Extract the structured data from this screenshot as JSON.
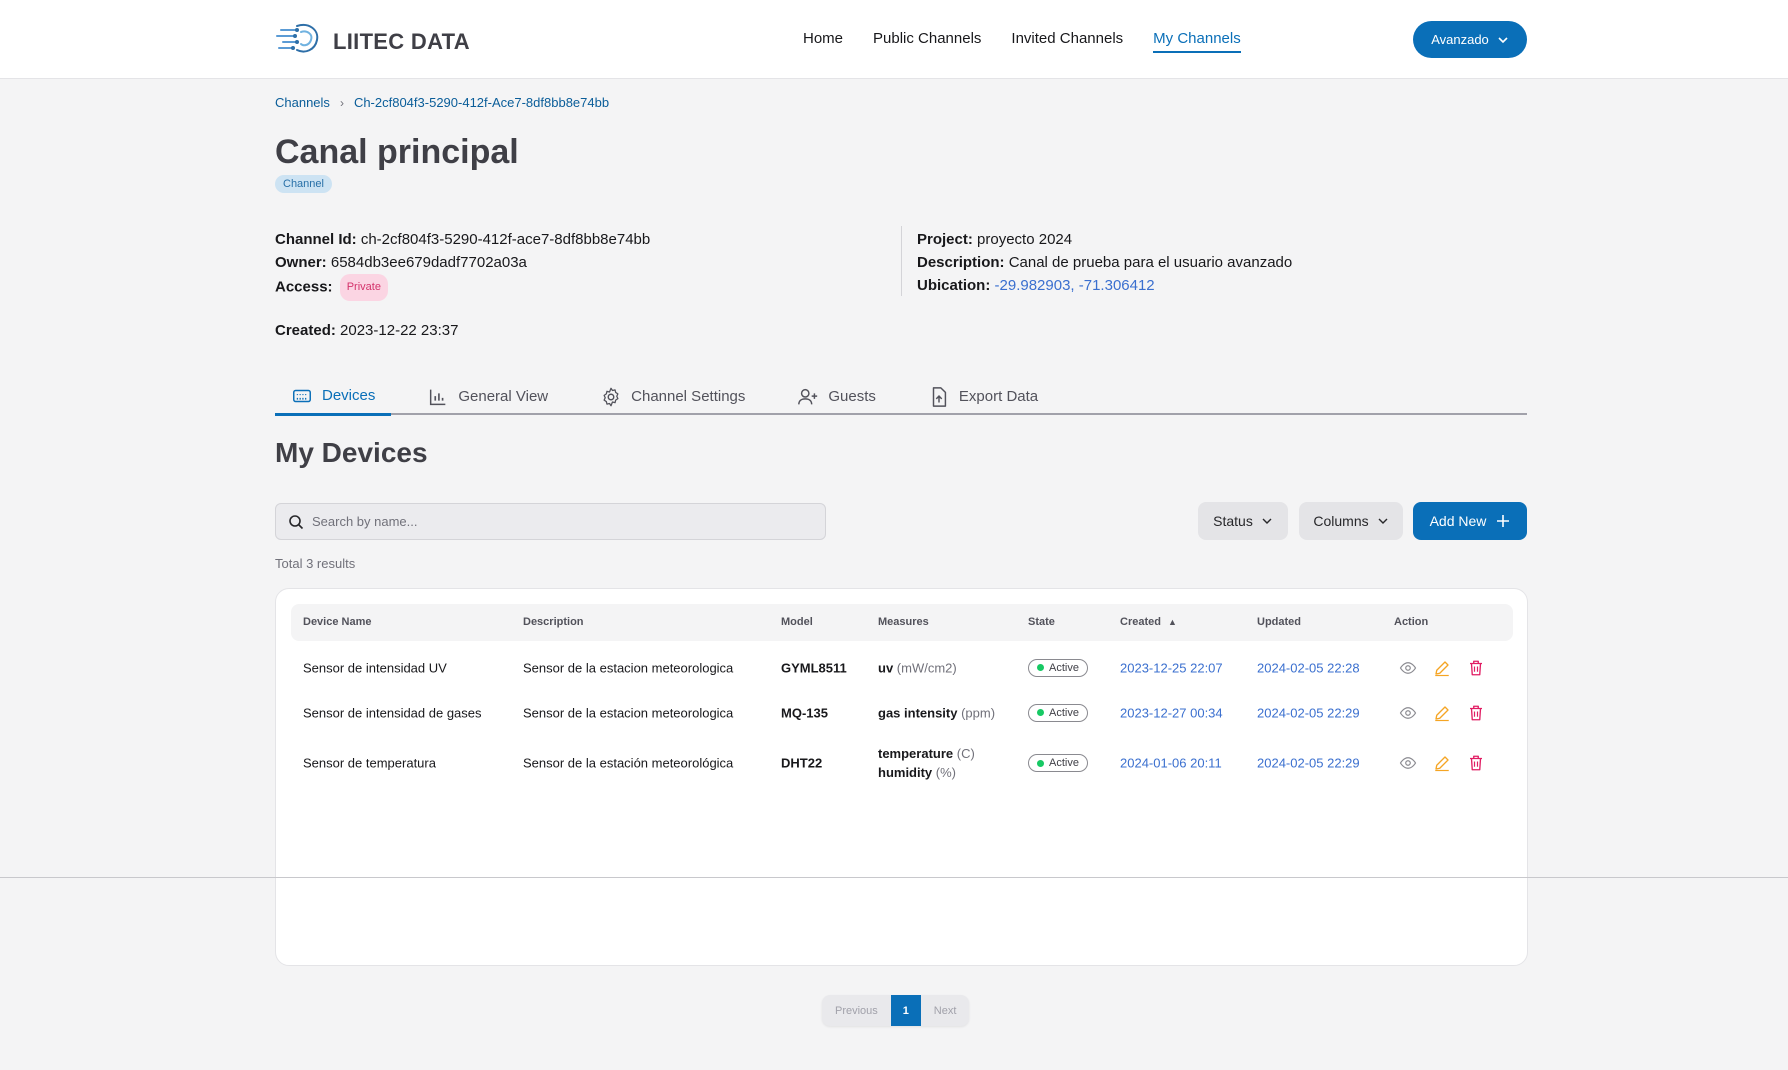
{
  "header": {
    "brand": "LIITEC DATA",
    "nav": [
      "Home",
      "Public Channels",
      "Invited Channels",
      "My Channels"
    ],
    "active_nav": "My Channels",
    "user_button": "Avanzado"
  },
  "breadcrumb": {
    "root": "Channels",
    "current": "Ch-2cf804f3-5290-412f-Ace7-8df8bb8e74bb"
  },
  "channel": {
    "title": "Canal principal",
    "type_chip": "Channel",
    "id_label": "Channel Id:",
    "id_value": "ch-2cf804f3-5290-412f-ace7-8df8bb8e74bb",
    "owner_label": "Owner:",
    "owner_value": "6584db3ee679dadf7702a03a",
    "access_label": "Access:",
    "access_value": "Private",
    "project_label": "Project:",
    "project_value": "proyecto 2024",
    "description_label": "Description:",
    "description_value": "Canal de prueba para el usuario avanzado",
    "ubication_label": "Ubication:",
    "ubication_value": "-29.982903, -71.306412",
    "created_label": "Created:",
    "created_value": "2023-12-22 23:37"
  },
  "tabs": {
    "devices": "Devices",
    "general_view": "General View",
    "channel_settings": "Channel Settings",
    "guests": "Guests",
    "export_data": "Export Data"
  },
  "devices": {
    "section_title": "My Devices",
    "search_placeholder": "Search by name...",
    "status_button": "Status",
    "columns_button": "Columns",
    "add_button": "Add New",
    "total": "Total 3 results",
    "columns": {
      "name": "Device Name",
      "description": "Description",
      "model": "Model",
      "measures": "Measures",
      "state": "State",
      "created": "Created",
      "updated": "Updated",
      "action": "Action"
    },
    "rows": [
      {
        "name": "Sensor de intensidad UV",
        "description": "Sensor de la estacion meteorologica",
        "model": "GYML8511",
        "measure1_name": "uv",
        "measure1_unit": "(mW/cm2)",
        "state": "Active",
        "created": "2023-12-25 22:07",
        "updated": "2024-02-05 22:28"
      },
      {
        "name": "Sensor de intensidad de gases",
        "description": "Sensor de la estacion meteorologica",
        "model": "MQ-135",
        "measure1_name": "gas intensity",
        "measure1_unit": "(ppm)",
        "state": "Active",
        "created": "2023-12-27 00:34",
        "updated": "2024-02-05 22:29"
      },
      {
        "name": "Sensor de temperatura",
        "description": "Sensor de la estación meteorológica",
        "model": "DHT22",
        "measure1_name": "temperature",
        "measure1_unit": "(C)",
        "measure2_name": "humidity",
        "measure2_unit": "(%)",
        "state": "Active",
        "created": "2024-01-06 20:11",
        "updated": "2024-02-05 22:29"
      }
    ]
  },
  "pagination": {
    "previous": "Previous",
    "current": "1",
    "next": "Next"
  },
  "colors": {
    "primary": "#0a6fb8",
    "link": "#3a6fcf",
    "active_dot": "#17c964",
    "edit_icon": "#f5a524",
    "delete_icon": "#e11d63"
  }
}
